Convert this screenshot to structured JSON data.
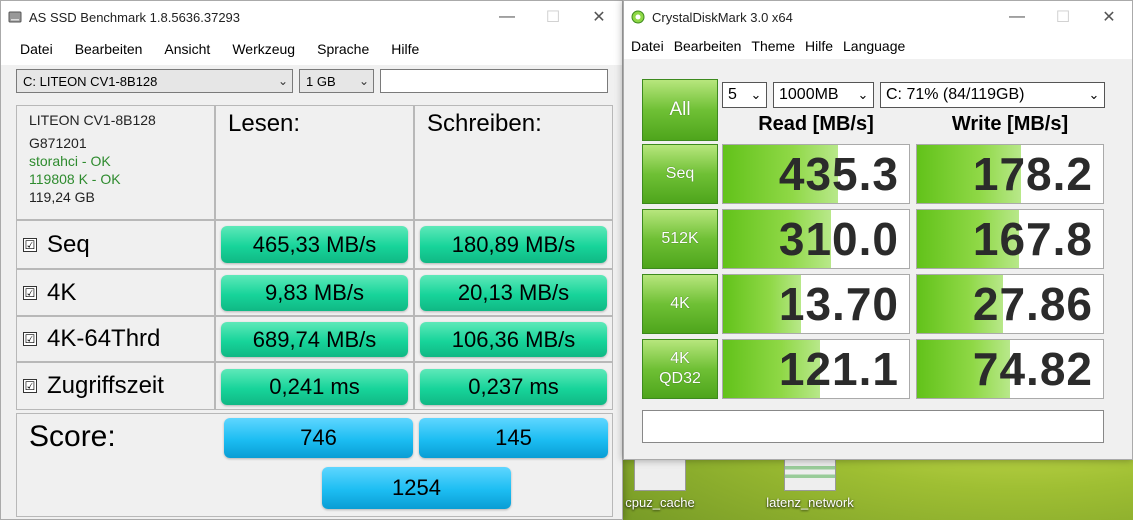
{
  "desktop": {
    "icons": [
      {
        "label": "cpuz_cache"
      },
      {
        "label": "latenz_network"
      }
    ]
  },
  "asssd": {
    "title": "AS SSD Benchmark 1.8.5636.37293",
    "menu": [
      "Datei",
      "Bearbeiten",
      "Ansicht",
      "Werkzeug",
      "Sprache",
      "Hilfe"
    ],
    "drive_select": "C: LITEON CV1-8B128",
    "size_select": "1 GB",
    "drive_info": {
      "model": "LITEON CV1-8B128",
      "firmware": "G871201",
      "driver": "storahci - OK",
      "alignment": "119808 K - OK",
      "capacity": "119,24 GB"
    },
    "headers": {
      "read": "Lesen:",
      "write": "Schreiben:"
    },
    "rows": [
      {
        "label": "Seq",
        "read": "465,33 MB/s",
        "write": "180,89 MB/s"
      },
      {
        "label": "4K",
        "read": "9,83 MB/s",
        "write": "20,13 MB/s"
      },
      {
        "label": "4K-64Thrd",
        "read": "689,74 MB/s",
        "write": "106,36 MB/s"
      },
      {
        "label": "Zugriffszeit",
        "read": "0,241 ms",
        "write": "0,237 ms"
      }
    ],
    "checkbox_mark": "☑",
    "score": {
      "label": "Score:",
      "read": "746",
      "write": "145",
      "total": "1254"
    },
    "colors": {
      "result_green": "#17d49a",
      "score_blue": "#1cbdf2"
    }
  },
  "cdm": {
    "title": "CrystalDiskMark 3.0 x64",
    "menu": [
      "Datei",
      "Bearbeiten",
      "Theme",
      "Hilfe",
      "Language"
    ],
    "all_button": "All",
    "runs_select": "5",
    "size_select": "1000MB",
    "drive_select": "C: 71% (84/119GB)",
    "headers": {
      "read": "Read [MB/s]",
      "write": "Write [MB/s]"
    },
    "rows": [
      {
        "label": "Seq",
        "read": "435.3",
        "write": "178.2",
        "read_fill": 0.62,
        "write_fill": 0.56
      },
      {
        "label": "512K",
        "read": "310.0",
        "write": "167.8",
        "read_fill": 0.58,
        "write_fill": 0.55
      },
      {
        "label": "4K",
        "read": "13.70",
        "write": "27.86",
        "read_fill": 0.42,
        "write_fill": 0.46
      },
      {
        "label": "4K\nQD32",
        "read": "121.1",
        "write": "74.82",
        "read_fill": 0.52,
        "write_fill": 0.5
      }
    ],
    "colors": {
      "button_green": "#6fc035",
      "bar_green": "#62c21a"
    }
  }
}
